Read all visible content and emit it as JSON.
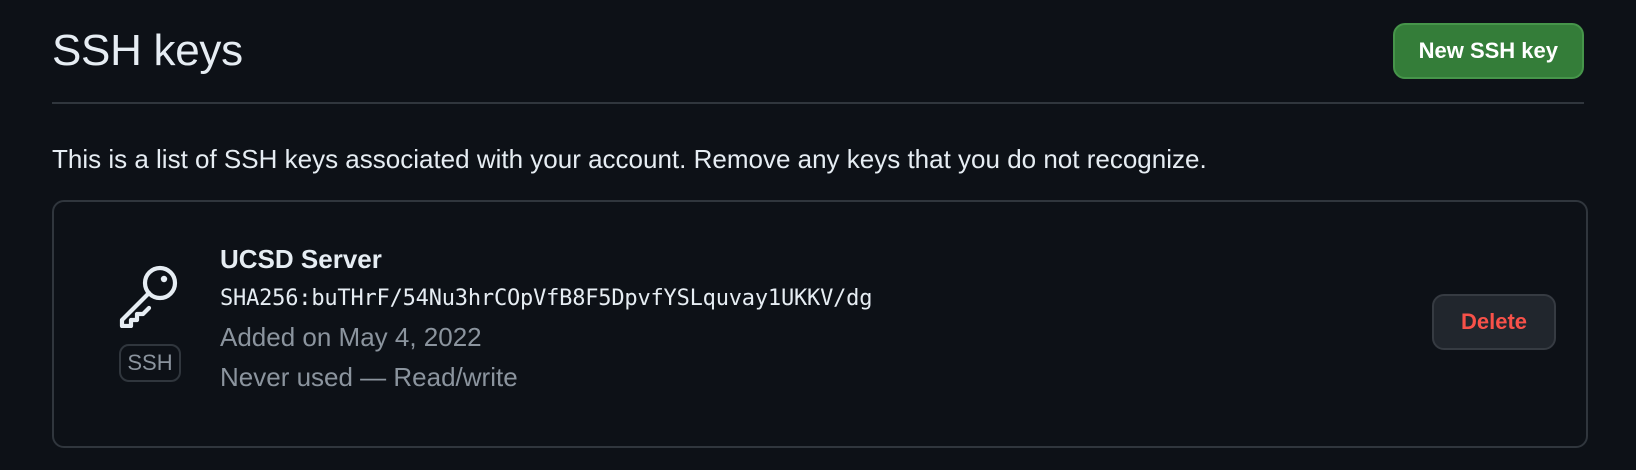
{
  "header": {
    "title": "SSH keys",
    "new_key_label": "New SSH key"
  },
  "description": "This is a list of SSH keys associated with your account. Remove any keys that you do not recognize.",
  "keys": [
    {
      "icon": "key-icon",
      "type_badge": "SSH",
      "title": "UCSD Server",
      "fingerprint": "SHA256:buTHrF/54Nu3hrCOpVfB8F5DpvfYSLquvay1UKKV/dg",
      "added": "Added on May 4, 2022",
      "usage": "Never used — Read/write",
      "delete_label": "Delete"
    }
  ],
  "colors": {
    "background": "#0d1117",
    "border": "#30363d",
    "primary_button": "#347d39",
    "danger_text": "#f85149",
    "muted_text": "#8b949e",
    "text": "#e6edf3"
  }
}
